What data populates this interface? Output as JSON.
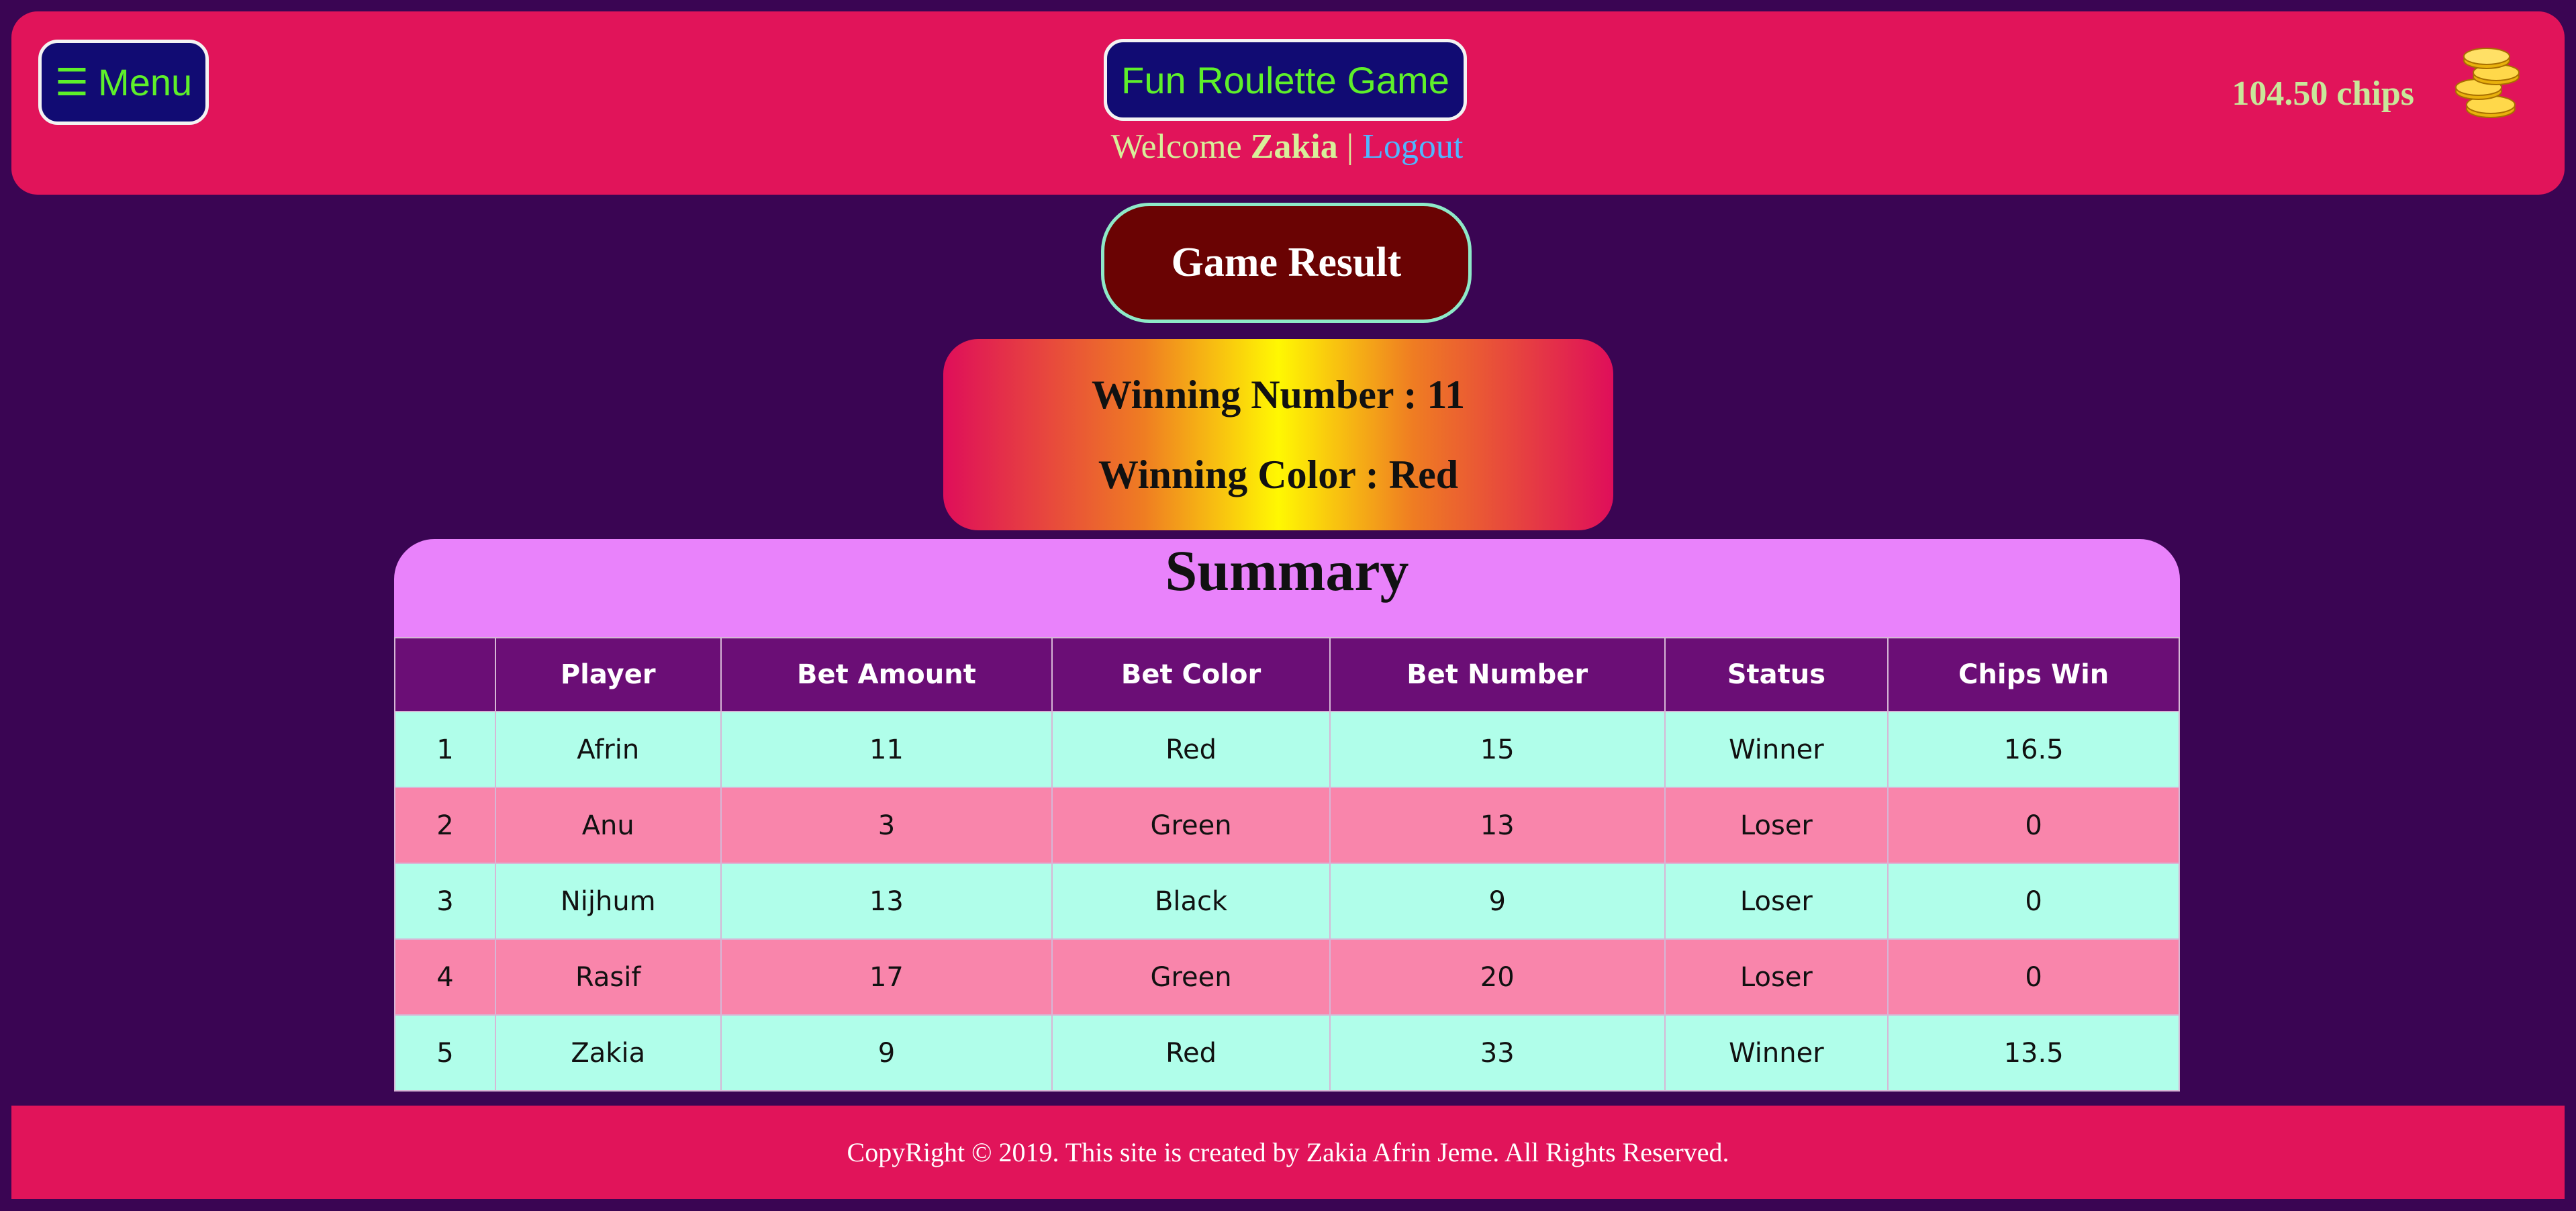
{
  "header": {
    "menu_icon": "☰",
    "menu_label": "Menu",
    "title": "Fun Roulette Game",
    "welcome_prefix": "Welcome",
    "username": "Zakia",
    "separator": "|",
    "logout_label": "Logout",
    "chips_text": "104.50 chips",
    "coin_icon": "gold-coins-icon"
  },
  "result": {
    "button_label": "Game Result",
    "winning_number": "Winning Number : 11",
    "winning_color": "Winning Color : Red"
  },
  "summary": {
    "title": "Summary",
    "columns": [
      "",
      "Player",
      "Bet Amount",
      "Bet Color",
      "Bet Number",
      "Status",
      "Chips Win"
    ],
    "rows": [
      [
        "1",
        "Afrin",
        "11",
        "Red",
        "15",
        "Winner",
        "16.5"
      ],
      [
        "2",
        "Anu",
        "3",
        "Green",
        "13",
        "Loser",
        "0"
      ],
      [
        "3",
        "Nijhum",
        "13",
        "Black",
        "9",
        "Loser",
        "0"
      ],
      [
        "4",
        "Rasif",
        "17",
        "Green",
        "20",
        "Loser",
        "0"
      ],
      [
        "5",
        "Zakia",
        "9",
        "Red",
        "33",
        "Winner",
        "13.5"
      ]
    ]
  },
  "footer": {
    "text": "CopyRight © 2019. This site is created by Zakia Afrin Jeme. All Rights Reserved."
  },
  "colors": {
    "background": "#3a0553",
    "header": "#e1145a",
    "button_navy": "#110b73",
    "neon_green": "#5ef02a",
    "result_red": "#6a0303",
    "summary_pink": "#e982fb",
    "table_header": "#6b0e76",
    "row_mint": "#b0feea",
    "row_pink": "#f985ab"
  }
}
